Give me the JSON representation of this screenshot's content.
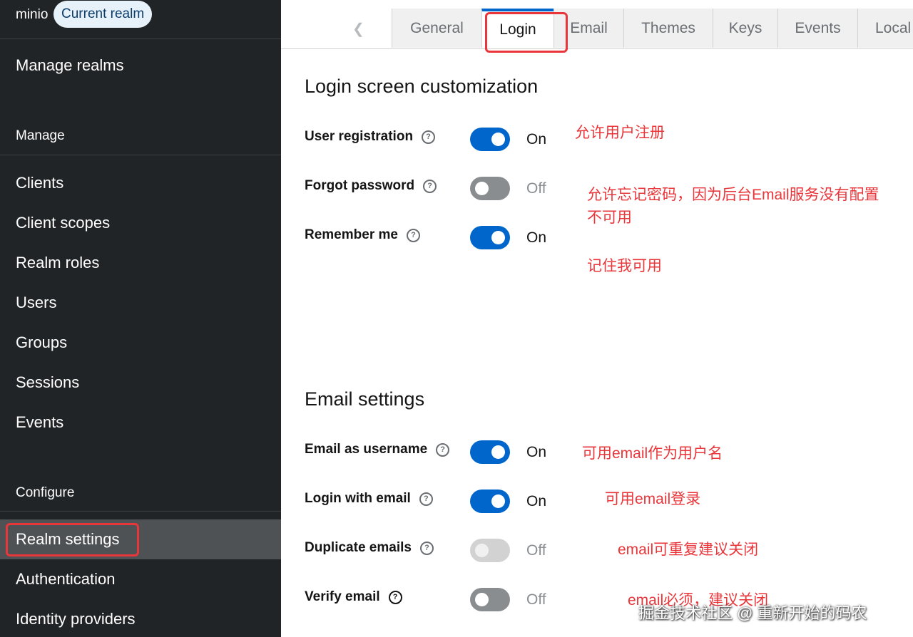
{
  "realm": {
    "name": "minio",
    "badge": "Current realm"
  },
  "sidebar": {
    "manage_realms": "Manage realms",
    "manage_section": "Manage",
    "manage_items": [
      "Clients",
      "Client scopes",
      "Realm roles",
      "Users",
      "Groups",
      "Sessions",
      "Events"
    ],
    "configure_section": "Configure",
    "configure_items": [
      "Realm settings",
      "Authentication",
      "Identity providers"
    ],
    "active_item": "Realm settings"
  },
  "tabs": {
    "scroll_left_icon": "chevron-left-icon",
    "items": [
      "General",
      "Login",
      "Email",
      "Themes",
      "Keys",
      "Events",
      "Local"
    ],
    "active": "Login"
  },
  "login_section": {
    "title": "Login screen customization",
    "fields": [
      {
        "label": "User registration",
        "state": "On",
        "note": "允许用户注册"
      },
      {
        "label": "Forgot password",
        "state": "Off",
        "note": "允许忘记密码，因为后台Email服务没有配置",
        "note2": "不可用"
      },
      {
        "label": "Remember me",
        "state": "On",
        "note": "记住我可用"
      }
    ]
  },
  "email_section": {
    "title": "Email settings",
    "fields": [
      {
        "label": "Email as username",
        "state": "On",
        "note": "可用email作为用户名"
      },
      {
        "label": "Login with email",
        "state": "On",
        "note": "可用email登录"
      },
      {
        "label": "Duplicate emails",
        "state": "Off",
        "note": "email可重复建议关闭"
      },
      {
        "label": "Verify email",
        "state": "Off",
        "note": "email必须，建议关闭"
      }
    ]
  },
  "help_icon_glyph": "?",
  "watermark": "掘金技术社区 @ 重新开始的码农",
  "colors": {
    "sidebar_bg": "#212427",
    "active_nav_bg": "#4f5255",
    "switch_on": "#0066cc",
    "switch_off": "#8a8d90",
    "annotation_red": "#e8363a"
  }
}
